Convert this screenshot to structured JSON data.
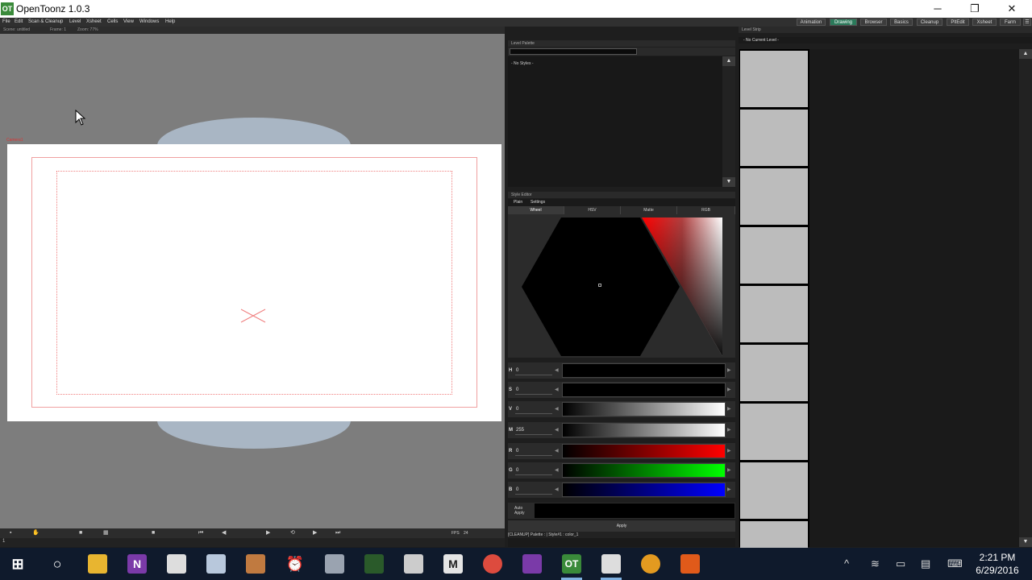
{
  "window": {
    "title": "OpenToonz 1.0.3",
    "logo": "OT",
    "minimize_icon": "─",
    "restore_icon": "❐",
    "close_icon": "✕"
  },
  "menu": [
    "File",
    "Edit",
    "Scan & Cleanup",
    "Level",
    "Xsheet",
    "Cells",
    "View",
    "Windows",
    "Help"
  ],
  "rooms": {
    "items": [
      "Animation",
      "Drawing",
      "Browser",
      "Basics",
      "Cleanup",
      "PltEdit",
      "Xsheet",
      "Farm"
    ],
    "active": "Drawing"
  },
  "viewer": {
    "scene": "Scene: untitled",
    "frame": "Frame: 1",
    "zoom": "Zoom: 77%",
    "camera_label": "Camera1",
    "fps_label": "FPS",
    "fps_value": "24",
    "frame_field": "1"
  },
  "level_palette": {
    "title": "Level Palette",
    "no_styles": "- No Styles -"
  },
  "style_editor": {
    "title": "Style Editor",
    "tabs": [
      "Plain",
      "Settings"
    ],
    "modes": [
      "Wheel",
      "HSV",
      "Matte",
      "RGB"
    ],
    "active_mode": "Wheel",
    "channels": [
      {
        "label": "H",
        "value": "0"
      },
      {
        "label": "S",
        "value": "0"
      },
      {
        "label": "V",
        "value": "0"
      },
      {
        "label": "M",
        "value": "255"
      },
      {
        "label": "R",
        "value": "0"
      },
      {
        "label": "G",
        "value": "0"
      },
      {
        "label": "B",
        "value": "0"
      }
    ],
    "auto_apply": "Auto\nApply",
    "apply": "Apply",
    "status": "[CLEANUP]  Palette : | Style#1 : color_1"
  },
  "level_strip": {
    "title": "Level Strip",
    "no_level": "- No Current Level -",
    "frame_count": 9
  },
  "taskbar": {
    "icons": [
      "windows-icon",
      "cortana-icon",
      "file-explorer-icon",
      "onenote-icon",
      "document-icon",
      "network-icon",
      "photo-icon",
      "alarm-icon",
      "paint-icon",
      "movie-icon",
      "presentation-icon",
      "m-app-icon",
      "chrome-icon",
      "visual-studio-icon",
      "opentoonz-icon",
      "image-viewer-icon",
      "app-icon",
      "microphone-icon"
    ],
    "clock_time": "2:21 PM",
    "clock_date": "6/29/2016"
  }
}
